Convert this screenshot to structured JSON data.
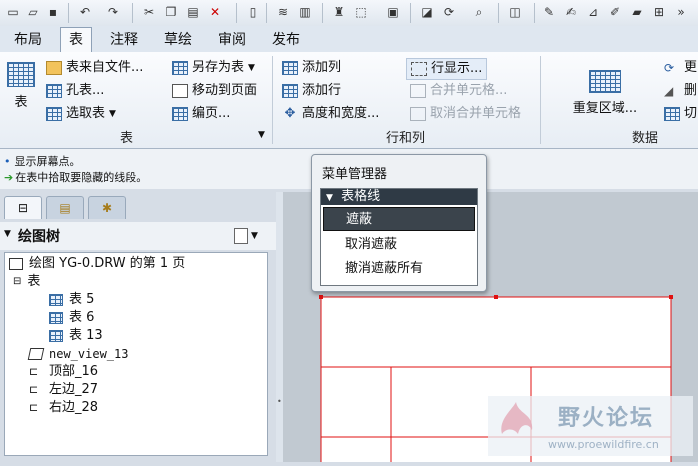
{
  "tabs": [
    "布局",
    "表",
    "注释",
    "草绘",
    "审阅",
    "发布"
  ],
  "active_tab": "表",
  "ribbon": {
    "table_group": {
      "big_button": "表",
      "items": [
        "表来自文件...",
        "孔表...",
        "选取表",
        "另存为表",
        "移动到页面",
        "编页..."
      ],
      "label": "表"
    },
    "rows_cols_group": {
      "items": [
        "添加列",
        "添加行",
        "高度和宽度...",
        "行显示...",
        "合并单元格...",
        "取消合并单元格"
      ],
      "label": "行和列"
    },
    "data_group": {
      "big_button": "重复区域...",
      "items": [
        "更",
        "删",
        "切"
      ],
      "label": "数据"
    }
  },
  "status": {
    "line1": "显示屏幕点。",
    "line2": "在表中拾取要隐藏的线段。"
  },
  "tree": {
    "title": "绘图树",
    "items": [
      "绘图 YG-0.DRW 的第 1 页",
      "表",
      "表 5",
      "表 6",
      "表 13",
      "new_view_13",
      "顶部_16",
      "左边_27",
      "右边_28"
    ]
  },
  "menu": {
    "title": "菜单管理器",
    "header": "表格线",
    "items": [
      "遮蔽",
      "取消遮蔽",
      "撤消遮蔽所有"
    ],
    "selected_index": 0
  },
  "watermark": {
    "title": "野火论坛",
    "url": "www.proewildfire.cn"
  },
  "colors": {
    "accent": "#2f3a45",
    "table_lines": "#e01010"
  }
}
